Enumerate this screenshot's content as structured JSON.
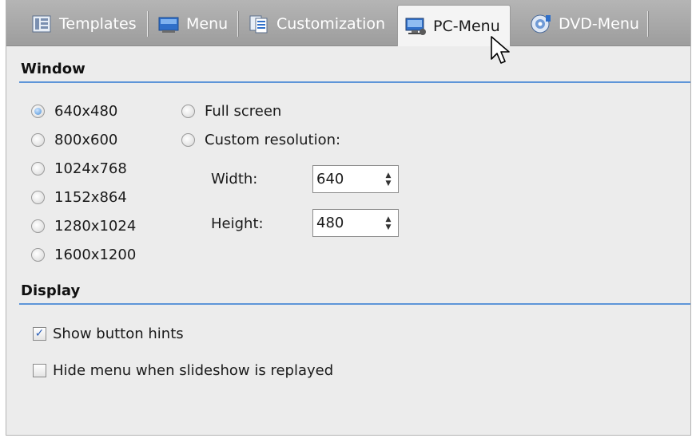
{
  "tabs": [
    {
      "label": "Templates",
      "icon": "templates-icon"
    },
    {
      "label": "Menu",
      "icon": "menu-icon"
    },
    {
      "label": "Customization",
      "icon": "customization-icon"
    },
    {
      "label": "PC-Menu",
      "icon": "pc-menu-icon",
      "active": true
    },
    {
      "label": "DVD-Menu",
      "icon": "dvd-icon"
    }
  ],
  "window_section": {
    "title": "Window",
    "resolutions": [
      {
        "label": "640x480",
        "checked": true
      },
      {
        "label": "800x600",
        "checked": false
      },
      {
        "label": "1024x768",
        "checked": false
      },
      {
        "label": "1152x864",
        "checked": false
      },
      {
        "label": "1280x1024",
        "checked": false
      },
      {
        "label": "1600x1200",
        "checked": false
      }
    ],
    "full_screen_label": "Full screen",
    "custom_resolution_label": "Custom resolution:",
    "width_label": "Width:",
    "width_value": "640",
    "height_label": "Height:",
    "height_value": "480"
  },
  "display_section": {
    "title": "Display",
    "show_button_hints_label": "Show button hints",
    "show_button_hints_checked": true,
    "hide_menu_label": "Hide menu when slideshow is replayed",
    "hide_menu_checked": false
  },
  "colors": {
    "accent_rule": "#5e95d8",
    "tabstrip": "#a8a8a8",
    "panel": "#ececec"
  }
}
